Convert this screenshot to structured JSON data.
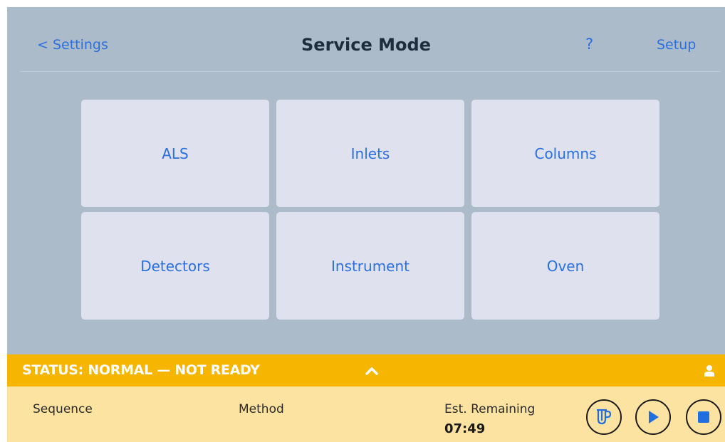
{
  "header": {
    "back_label": "< Settings",
    "title": "Service Mode",
    "help_label": "?",
    "setup_label": "Setup"
  },
  "tiles": [
    {
      "label": "ALS"
    },
    {
      "label": "Inlets"
    },
    {
      "label": "Columns"
    },
    {
      "label": "Detectors"
    },
    {
      "label": "Instrument"
    },
    {
      "label": "Oven"
    }
  ],
  "status": {
    "text": "STATUS: NORMAL — NOT READY",
    "expand_icon": "chevron-up-icon",
    "user_icon": "user-icon"
  },
  "run_info": {
    "sequence_label": "Sequence",
    "method_label": "Method",
    "remaining_label": "Est. Remaining",
    "remaining_value": "07:49"
  },
  "controls": {
    "prep_icon": "prep-run-icon",
    "play_icon": "play-icon",
    "stop_icon": "stop-icon"
  },
  "colors": {
    "background": "#acbbc9",
    "tile": "#dfe2ee",
    "accent": "#2a6fe0",
    "status_bar": "#f6b500",
    "info_bar": "#fde3a2",
    "control_icon": "#1f6fe0"
  }
}
